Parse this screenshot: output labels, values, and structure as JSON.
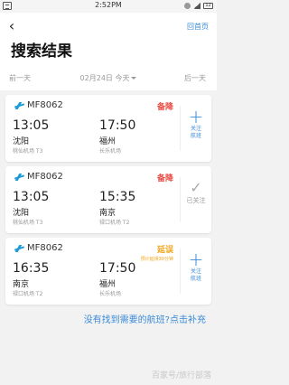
{
  "status_bar": {
    "time": "2:52PM",
    "battery": "12"
  },
  "header": {
    "home_label": "回首页",
    "title": "搜索结果",
    "prev_day": "前一天",
    "date_label": "02月24日 今天",
    "next_day": "后一天"
  },
  "flights": [
    {
      "flight_no": "MF8062",
      "status": "备降",
      "status_color": "#e94b43",
      "dep_time": "13:05",
      "dep_city": "沈阳",
      "dep_airport": "桃仙机场 T3",
      "arr_time": "17:50",
      "arr_city": "福州",
      "arr_airport": "长乐机场",
      "follow_label_1": "关注",
      "follow_label_2": "航班"
    },
    {
      "flight_no": "MF8062",
      "status": "备降",
      "status_color": "#e94b43",
      "dep_time": "13:05",
      "dep_city": "沈阳",
      "dep_airport": "桃仙机场 T3",
      "arr_time": "15:35",
      "arr_city": "南京",
      "arr_airport": "禄口机场 T2",
      "followed_label": "已关注"
    },
    {
      "flight_no": "MF8062",
      "status": "延误",
      "status_color": "#f1a51a",
      "delay_note": "预计延误30分钟",
      "dep_time": "16:35",
      "dep_city": "南京",
      "dep_airport": "禄口机场 T2",
      "arr_time": "17:50",
      "arr_city": "福州",
      "arr_airport": "长乐机场",
      "follow_label_1": "关注",
      "follow_label_2": "航班"
    }
  ],
  "not_found_link": "没有找到需要的航班?点击补充",
  "watermark": "百家号/旅行部落"
}
